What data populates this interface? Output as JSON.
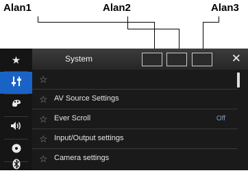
{
  "callouts": [
    "Alan1",
    "Alan2",
    "Alan3"
  ],
  "sidebar": {
    "items": [
      {
        "icon": "star-icon",
        "glyph": "★",
        "active": false
      },
      {
        "icon": "settings-icon",
        "glyph": "⚙",
        "active": true
      },
      {
        "icon": "theme-icon",
        "glyph": "◐",
        "active": false
      },
      {
        "icon": "audio-icon",
        "glyph": "🔊",
        "active": false
      },
      {
        "icon": "disc-icon",
        "glyph": "◉",
        "active": false
      },
      {
        "icon": "bluetooth-icon",
        "glyph": "ᛒ",
        "active": false
      }
    ]
  },
  "header": {
    "title": "System",
    "close_glyph": "✕"
  },
  "list": {
    "rows": [
      {
        "star": "☆",
        "label": "",
        "value": ""
      },
      {
        "star": "☆",
        "label": "AV Source Settings",
        "value": ""
      },
      {
        "star": "☆",
        "label": "Ever Scroll",
        "value": "Off"
      },
      {
        "star": "☆",
        "label": "Input/Output settings",
        "value": ""
      },
      {
        "star": "☆",
        "label": "Camera settings",
        "value": ""
      }
    ]
  },
  "colors": {
    "accent": "#1a63c6",
    "background": "#1a1a1a",
    "value_text": "#7fa0c8"
  }
}
